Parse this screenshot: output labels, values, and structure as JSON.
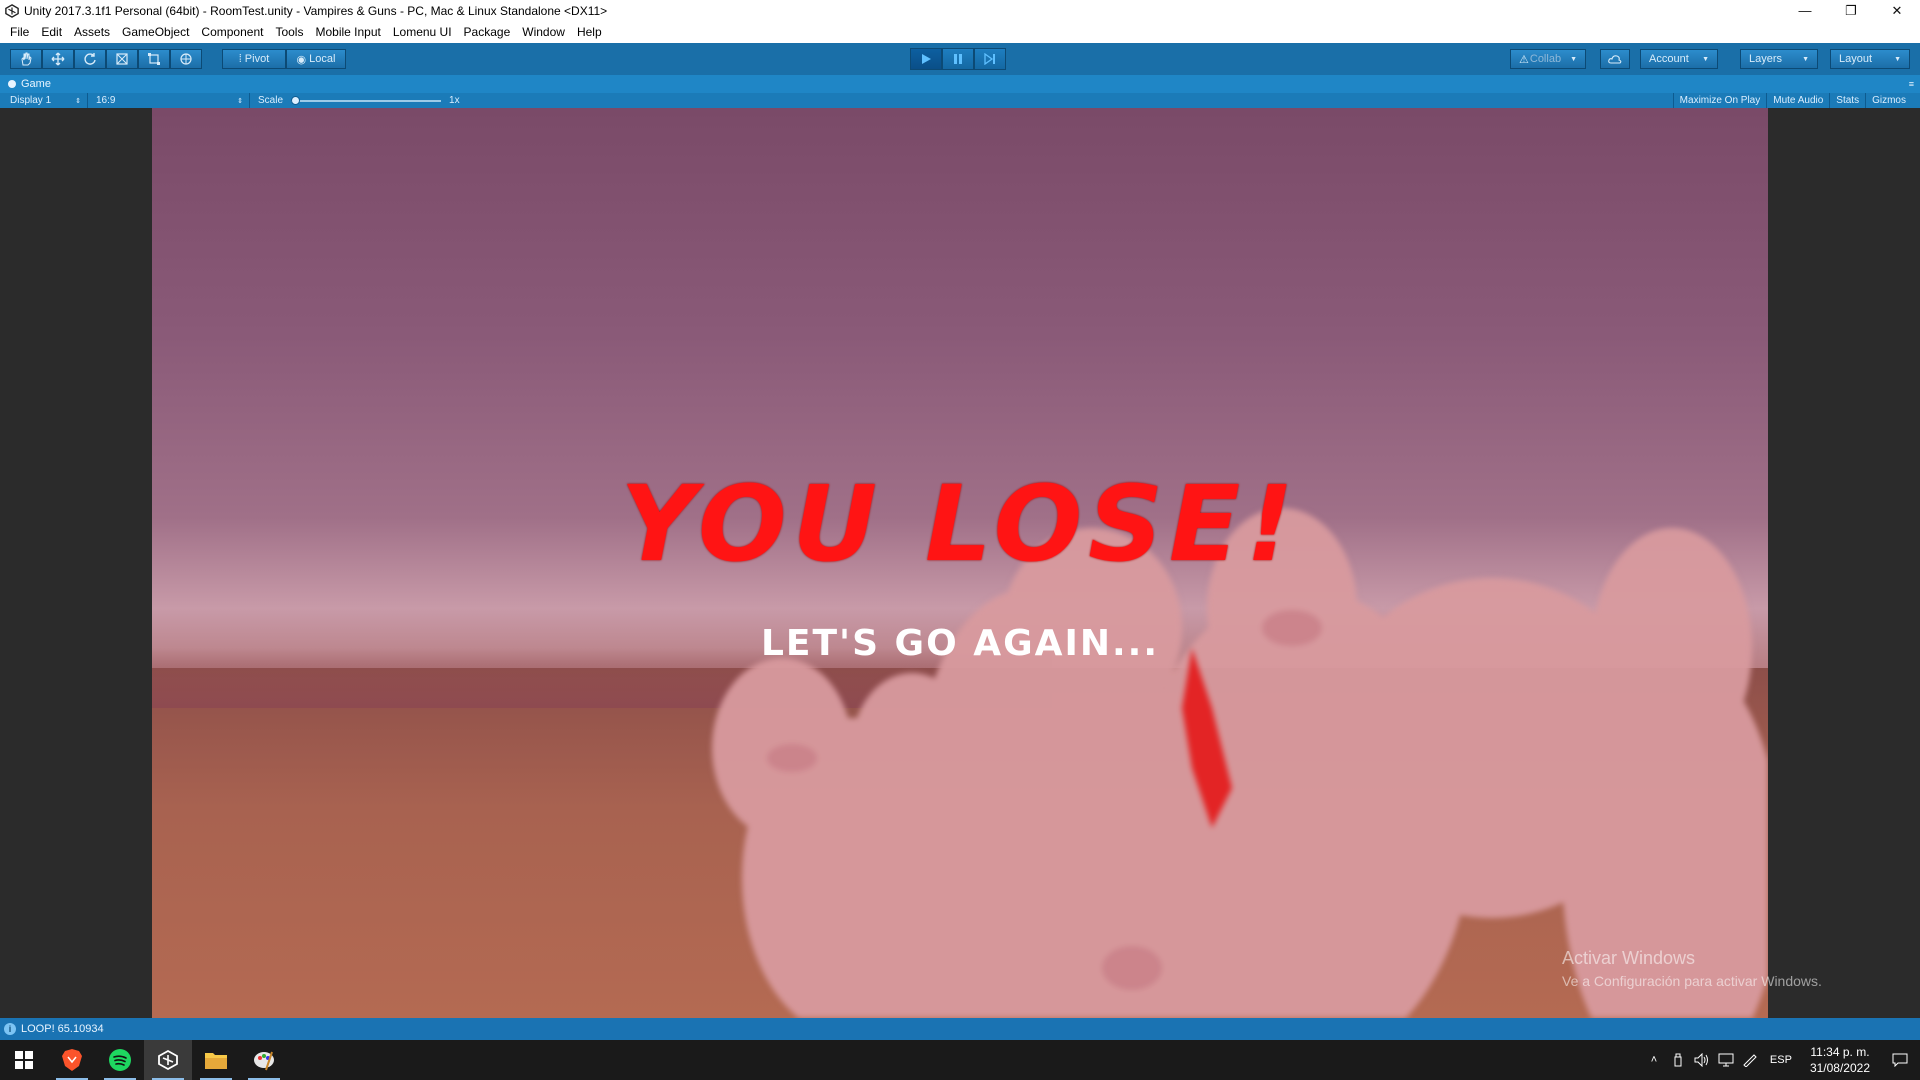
{
  "window": {
    "title": "Unity 2017.3.1f1 Personal (64bit) - RoomTest.unity - Vampires & Guns - PC, Mac & Linux Standalone <DX11>",
    "minimize": "—",
    "restore": "❐",
    "close": "✕"
  },
  "menu": [
    "File",
    "Edit",
    "Assets",
    "GameObject",
    "Component",
    "Tools",
    "Mobile Input",
    "Lomenu UI",
    "Package",
    "Window",
    "Help"
  ],
  "toolbar": {
    "pivot_label": "Pivot",
    "local_label": "Local",
    "collab_label": "Collab",
    "account_label": "Account",
    "layers_label": "Layers",
    "layout_label": "Layout",
    "colors": {
      "toolbar_bg": "#1a6fa8",
      "button": "#1c6ea8"
    }
  },
  "game_view": {
    "tab_label": "Game",
    "display": "Display 1",
    "aspect": "16:9",
    "scale_label": "Scale",
    "scale_value": "1x",
    "maximize_on_play": "Maximize On Play",
    "mute_audio": "Mute Audio",
    "stats": "Stats",
    "gizmos": "Gizmos"
  },
  "game": {
    "title": "YOU LOSE!",
    "subtitle": "LET'S GO AGAIN...",
    "title_color": "#ff1414"
  },
  "watermark": {
    "line1": "Activar Windows",
    "line2": "Ve a Configuración para activar Windows."
  },
  "status": {
    "message": "LOOP! 65.10934"
  },
  "taskbar": {
    "apps": [
      "windows-start",
      "brave-browser",
      "spotify",
      "unity",
      "file-explorer",
      "paint"
    ],
    "language": "ESP",
    "time": "11:34 p. m.",
    "date": "31/08/2022"
  }
}
